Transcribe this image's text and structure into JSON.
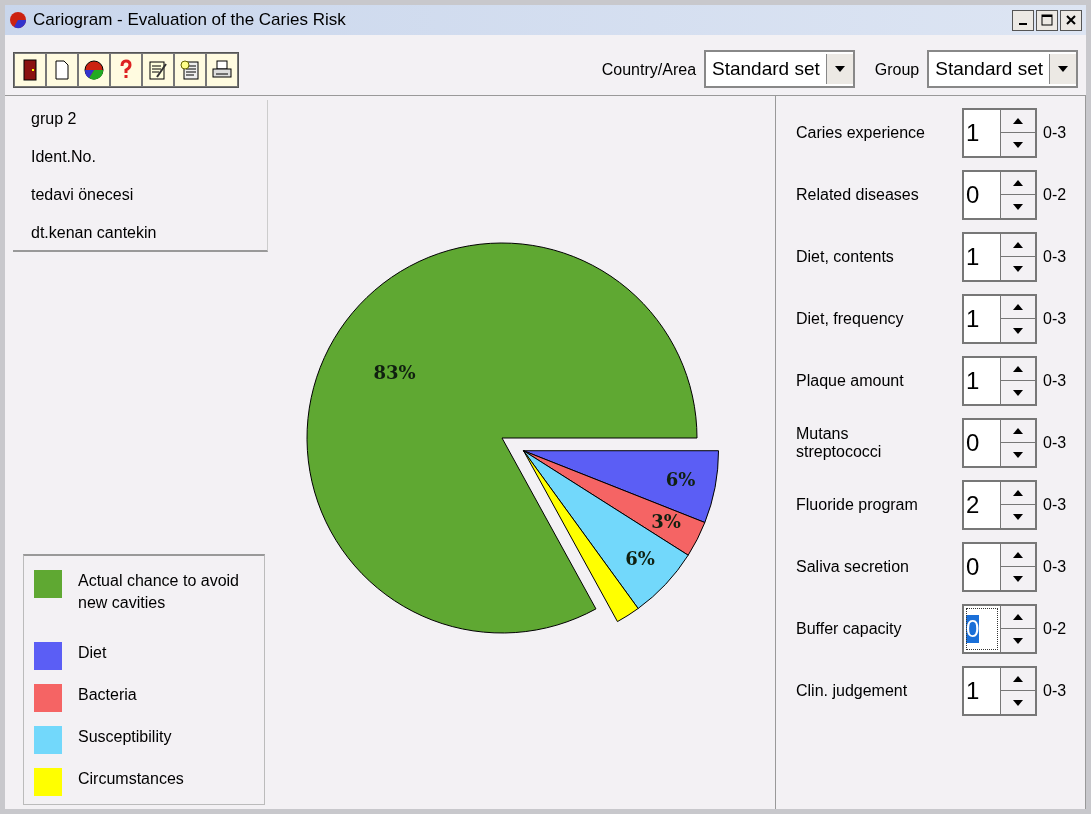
{
  "window": {
    "title": "Cariogram - Evaluation of the Caries Risk"
  },
  "toolbar": {
    "country_label": "Country/Area",
    "country_value": "Standard set",
    "group_label": "Group",
    "group_value": "Standard set"
  },
  "patient_info": [
    "grup 2",
    "Ident.No.",
    "tedavi önecesi",
    "dt.kenan cantekin"
  ],
  "legend": [
    {
      "label": "Actual chance to avoid new cavities",
      "color": "#5fa832"
    },
    {
      "label": "Diet",
      "color": "#5b5ef5"
    },
    {
      "label": "Bacteria",
      "color": "#f56464"
    },
    {
      "label": "Susceptibility",
      "color": "#72d8fb"
    },
    {
      "label": "Circumstances",
      "color": "#ffff00"
    }
  ],
  "chart_data": {
    "type": "pie",
    "values": [
      83,
      6,
      3,
      6,
      2
    ],
    "value_labels": [
      "83%",
      "6%",
      "3%",
      "6%",
      null
    ]
  },
  "factors": [
    {
      "label": "Caries experience",
      "value": "1",
      "range": "0-3",
      "selected": false
    },
    {
      "label": "Related diseases",
      "value": "0",
      "range": "0-2",
      "selected": false
    },
    {
      "label": "Diet, contents",
      "value": "1",
      "range": "0-3",
      "selected": false
    },
    {
      "label": "Diet, frequency",
      "value": "1",
      "range": "0-3",
      "selected": false
    },
    {
      "label": "Plaque amount",
      "value": "1",
      "range": "0-3",
      "selected": false
    },
    {
      "label": "Mutans\nstreptococci",
      "value": "0",
      "range": "0-3",
      "selected": false
    },
    {
      "label": "Fluoride program",
      "value": "2",
      "range": "0-3",
      "selected": false
    },
    {
      "label": "Saliva secretion",
      "value": "0",
      "range": "0-3",
      "selected": false
    },
    {
      "label": "Buffer capacity",
      "value": "0",
      "range": "0-2",
      "selected": true
    },
    {
      "label": "Clin. judgement",
      "value": "1",
      "range": "0-3",
      "selected": false
    }
  ]
}
